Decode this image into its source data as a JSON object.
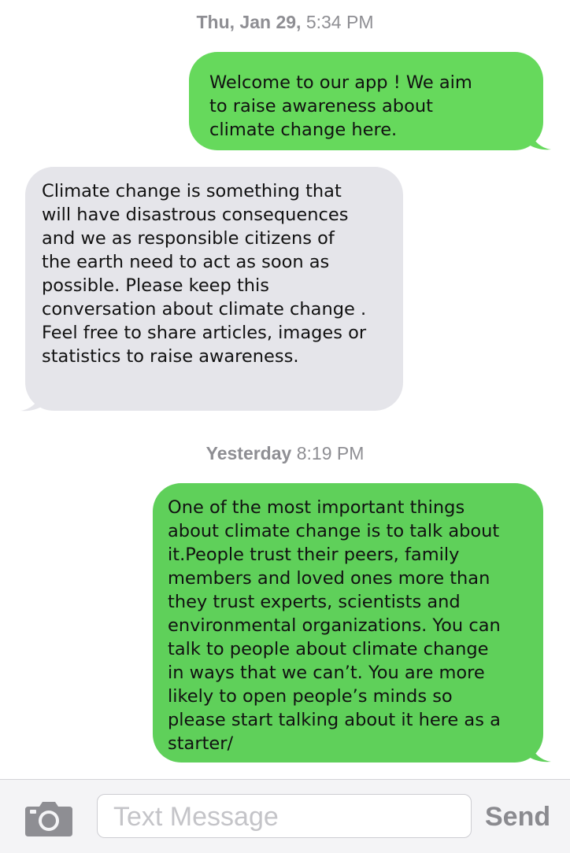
{
  "conversation": {
    "timestamps": [
      {
        "day": "Thu, Jan 29,",
        "time": "5:34 PM"
      },
      {
        "day": "Yesterday",
        "time": "8:19 PM"
      }
    ],
    "messages": [
      {
        "direction": "outgoing",
        "text": "Welcome to our app ! We aim\nto raise awareness about\nclimate change here."
      },
      {
        "direction": "incoming",
        "text": "Climate change is something that\nwill have disastrous consequences\nand we as responsible citizens of\nthe earth need to act as soon as\npossible. Please keep this\nconversation about climate change .\nFeel free to share articles, images or\nstatistics to raise awareness."
      },
      {
        "direction": "outgoing",
        "text": "One of the most important things\nabout climate change is to talk about\nit.People trust their peers, family\nmembers and loved ones more than\nthey trust experts, scientists and\nenvironmental organizations. You can\ntalk to people about climate change\nin ways that we can’t. You are more\nlikely to open people’s minds so\nplease start talking about it here as a\nstarter/"
      }
    ]
  },
  "composer": {
    "placeholder": "Text Message",
    "send_label": "Send",
    "camera_icon": "camera-icon"
  },
  "colors": {
    "outgoing_bubble": "#66d95c",
    "incoming_bubble": "#e5e5ea",
    "timestamp_text": "#8e8e93"
  }
}
